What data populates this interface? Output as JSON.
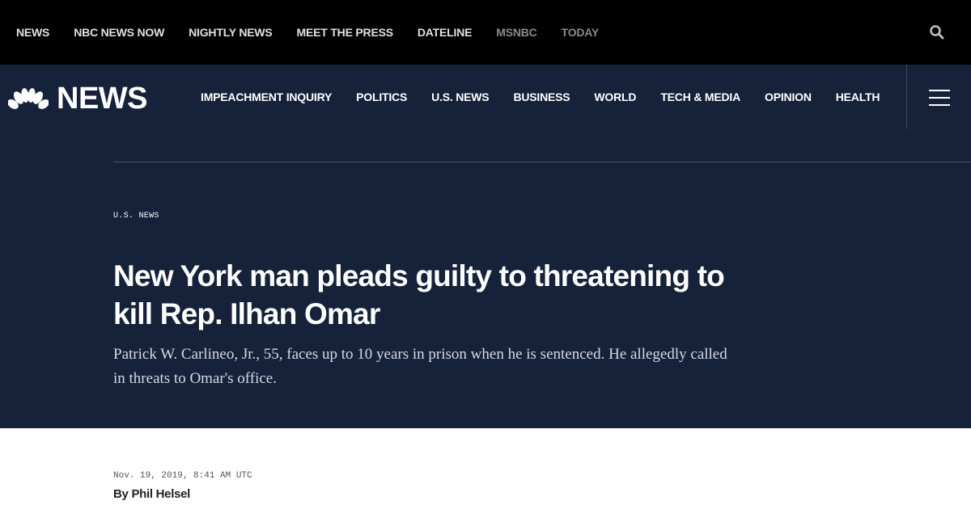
{
  "top_nav": {
    "items": [
      {
        "label": "NEWS",
        "dim": false
      },
      {
        "label": "NBC NEWS NOW",
        "dim": false
      },
      {
        "label": "NIGHTLY NEWS",
        "dim": false
      },
      {
        "label": "MEET THE PRESS",
        "dim": false
      },
      {
        "label": "DATELINE",
        "dim": false
      },
      {
        "label": "MSNBC",
        "dim": true
      },
      {
        "label": "TODAY",
        "dim": true
      }
    ],
    "search_icon": "search-icon"
  },
  "masthead": {
    "logo_text": "NEWS",
    "logo_icon": "peacock-icon",
    "nav": [
      "IMPEACHMENT INQUIRY",
      "POLITICS",
      "U.S. NEWS",
      "BUSINESS",
      "WORLD",
      "TECH & MEDIA",
      "OPINION",
      "HEALTH"
    ],
    "menu_icon": "hamburger-menu-icon"
  },
  "article": {
    "section": "U.S. NEWS",
    "headline": "New York man pleads guilty to threatening to kill Rep. Ilhan Omar",
    "dek": "Patrick W. Carlineo, Jr., 55, faces up to 10 years in prison when he is sentenced. He allegedly called in threats to Omar's office.",
    "date": "Nov. 19, 2019, 8:41 AM UTC",
    "byline_prefix": "By ",
    "author": "Phil Helsel"
  },
  "colors": {
    "top_bar": "#000000",
    "masthead": "#16223a",
    "dim_nav": "#8a8a8a",
    "text_light": "#ffffff"
  }
}
